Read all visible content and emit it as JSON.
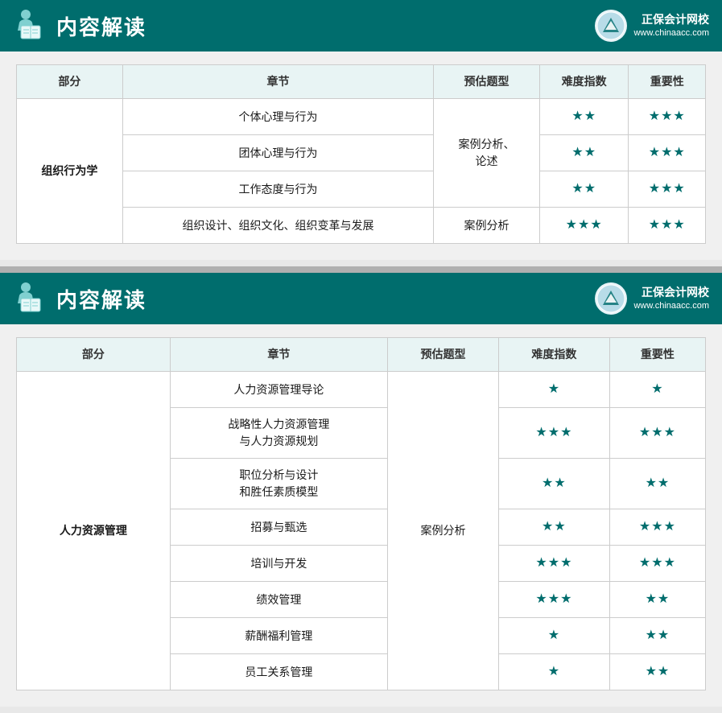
{
  "sections": [
    {
      "title": "内容解读",
      "logo_name": "正保会计网校",
      "logo_url": "www.chinaacc.com",
      "table": {
        "headers": [
          "部分",
          "章节",
          "预估题型",
          "难度指数",
          "重要性"
        ],
        "rows": [
          {
            "part": "组织行为学",
            "chapters": [
              {
                "name": "个体心理与行为",
                "exam_type": "",
                "difficulty": "★★",
                "importance": "★★★"
              },
              {
                "name": "团体心理与行为",
                "exam_type": "案例分析、\n论述",
                "difficulty": "★★",
                "importance": "★★★"
              },
              {
                "name": "工作态度与行为",
                "exam_type": "",
                "difficulty": "★★",
                "importance": "★★★"
              },
              {
                "name": "组织设计、组织文化、组织变革与发展",
                "exam_type": "案例分析",
                "difficulty": "★★★",
                "importance": "★★★"
              }
            ],
            "merged_exam_type": "案例分析、\n论述",
            "merge_rows": 3
          }
        ]
      }
    },
    {
      "title": "内容解读",
      "logo_name": "正保会计网校",
      "logo_url": "www.chinaacc.com",
      "table": {
        "headers": [
          "部分",
          "章节",
          "预估题型",
          "难度指数",
          "重要性"
        ],
        "rows": [
          {
            "part": "人力资源管理",
            "chapters": [
              {
                "name": "人力资源管理导论",
                "difficulty": "★",
                "importance": "★"
              },
              {
                "name": "战略性人力资源管理\n与人力资源规划",
                "difficulty": "★★★",
                "importance": "★★★"
              },
              {
                "name": "职位分析与设计\n和胜任素质模型",
                "difficulty": "★★",
                "importance": "★★"
              },
              {
                "name": "招募与甄选",
                "difficulty": "★★",
                "importance": "★★★"
              },
              {
                "name": "培训与开发",
                "difficulty": "★★★",
                "importance": "★★★"
              },
              {
                "name": "绩效管理",
                "difficulty": "★★★",
                "importance": "★★"
              },
              {
                "name": "薪酬福利管理",
                "difficulty": "★",
                "importance": "★★"
              },
              {
                "name": "员工关系管理",
                "difficulty": "★",
                "importance": "★★"
              }
            ],
            "merged_exam_type": "案例分析",
            "merge_rows": 8
          }
        ]
      }
    }
  ]
}
